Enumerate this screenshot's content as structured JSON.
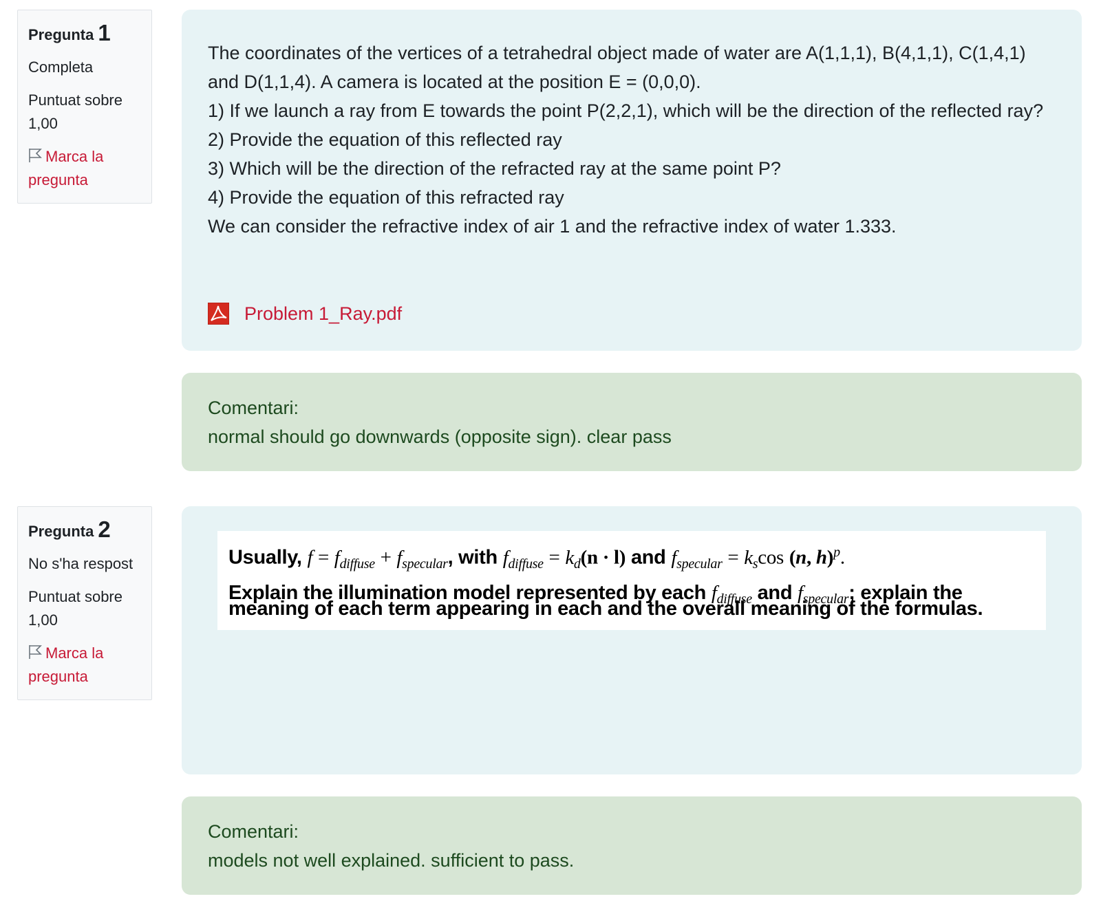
{
  "questions": [
    {
      "label": "Pregunta",
      "number": "1",
      "state": "Completa",
      "grade": "Puntuat sobre 1,00",
      "flag_label": "Marca la pregunta",
      "text": [
        "The coordinates of the vertices of a tetrahedral object made of water are A(1,1,1), B(4,1,1), C(1,4,1) and D(1,1,4). A camera is located at the position E = (0,0,0).",
        "1) If we launch a ray from E towards the point P(2,2,1), which will be the direction of the reflected ray?",
        "2) Provide the equation of this reflected ray",
        "3) Which will be the direction of the refracted ray at the same point P?",
        "4) Provide the equation of this refracted ray",
        "We can consider the refractive index of air 1 and the refractive index of water 1.333."
      ],
      "attachment": "Problem 1_Ray.pdf",
      "comment_label": "Comentari:",
      "comment_text": "normal should go downwards (opposite sign). clear pass"
    },
    {
      "label": "Pregunta",
      "number": "2",
      "state": "No s'ha respost",
      "grade": "Puntuat sobre 1,00",
      "flag_label": "Marca la pregunta",
      "image_text": {
        "usually": "Usually,",
        "with": ", with",
        "and": "and",
        "line2a": "Explain the illumination model represented by each",
        "line2b": "and",
        "line2c": "; explain the",
        "line3": "meaning of each term appearing in each and the overall meaning of the formulas."
      },
      "comment_label": "Comentari:",
      "comment_text": "models not well explained. sufficient to pass."
    }
  ],
  "colors": {
    "flag": "#c71a36",
    "question_bg": "#e7f3f5",
    "comment_bg": "#d7e6d5",
    "comment_text": "#1d4a1f"
  },
  "icons": [
    "flag-icon",
    "pdf-icon"
  ]
}
